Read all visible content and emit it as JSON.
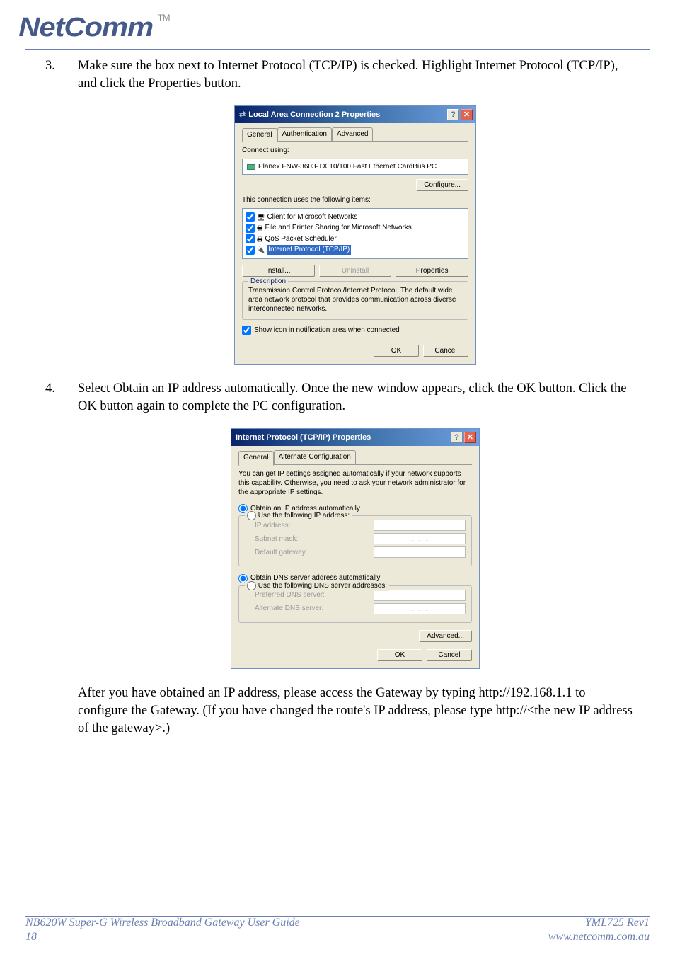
{
  "logo": {
    "text": "NetComm",
    "tm": "TM"
  },
  "steps": {
    "s3": {
      "num": "3.",
      "text": "Make sure the box next to Internet Protocol (TCP/IP) is checked. Highlight Internet Protocol (TCP/IP), and click the Properties button."
    },
    "s4": {
      "num": "4.",
      "text": "Select Obtain an IP address automatically. Once the new window appears, click the OK button. Click the OK button again to complete the PC configuration."
    }
  },
  "dialog1": {
    "title": "Local Area Connection 2 Properties",
    "tabs": {
      "t1": "General",
      "t2": "Authentication",
      "t3": "Advanced"
    },
    "connect_using": "Connect using:",
    "nic": "Planex FNW-3603-TX 10/100 Fast Ethernet CardBus PC",
    "configure": "Configure...",
    "uses_items": "This connection uses the following items:",
    "items": {
      "i1": "Client for Microsoft Networks",
      "i2": "File and Printer Sharing for Microsoft Networks",
      "i3": "QoS Packet Scheduler",
      "i4": "Internet Protocol (TCP/IP)"
    },
    "install": "Install...",
    "uninstall": "Uninstall",
    "properties": "Properties",
    "desc_legend": "Description",
    "desc_text": "Transmission Control Protocol/Internet Protocol. The default wide area network protocol that provides communication across diverse interconnected networks.",
    "show_icon": "Show icon in notification area when connected",
    "ok": "OK",
    "cancel": "Cancel"
  },
  "dialog2": {
    "title": "Internet Protocol (TCP/IP) Properties",
    "tabs": {
      "t1": "General",
      "t2": "Alternate Configuration"
    },
    "intro": "You can get IP settings assigned automatically if your network supports this capability. Otherwise, you need to ask your network administrator for the appropriate IP settings.",
    "r_auto_ip": "Obtain an IP address automatically",
    "r_use_ip": "Use the following IP address:",
    "ip_addr": "IP address:",
    "subnet": "Subnet mask:",
    "gateway": "Default gateway:",
    "r_auto_dns": "Obtain DNS server address automatically",
    "r_use_dns": "Use the following DNS server addresses:",
    "pref_dns": "Preferred DNS server:",
    "alt_dns": "Alternate DNS server:",
    "advanced": "Advanced...",
    "ok": "OK",
    "cancel": "Cancel"
  },
  "after": "After you have obtained an IP address, please access the Gateway by typing http://192.168.1.1 to configure the Gateway. (If you have changed the route's IP address, please type http://<the new IP address of the gateway>.)",
  "footer": {
    "left1": "NB620W Super-G Wireless Broadband  Gateway User Guide",
    "left2": "18",
    "right1": "YML725 Rev1",
    "right2": "www.netcomm.com.au"
  }
}
